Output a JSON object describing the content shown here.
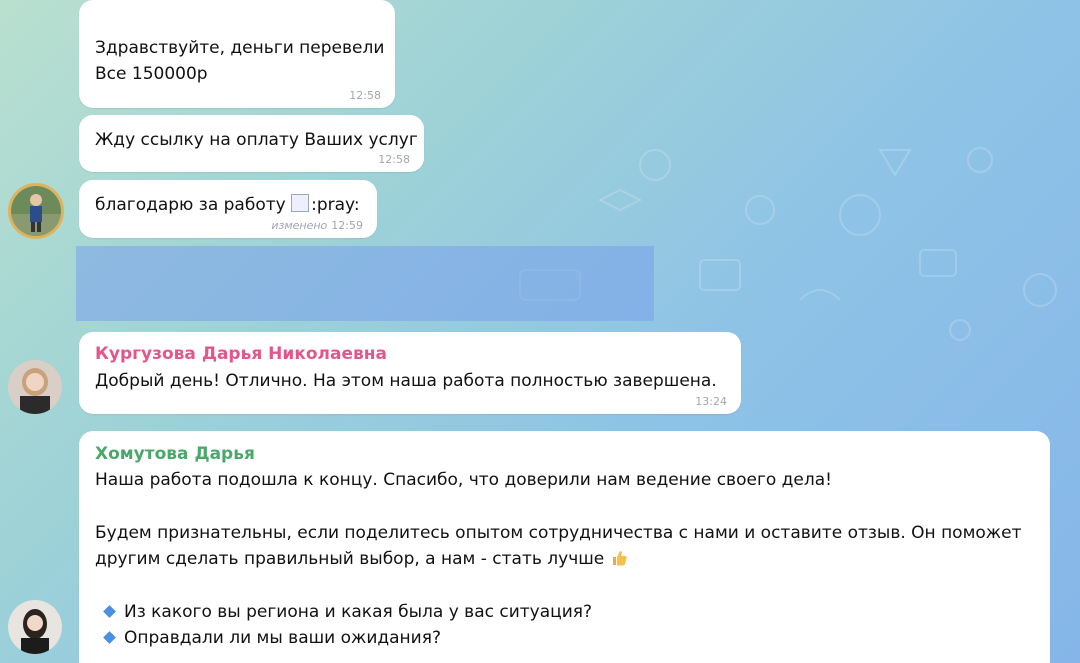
{
  "messages": [
    {
      "text": "Здравствуйте, деньги перевели\nВсе 150000р",
      "time": "12:58"
    },
    {
      "text": "Жду ссылку на оплату Ваших услуг",
      "time": "12:58"
    },
    {
      "text": "благодарю за работу",
      "emoji_alt": ":pray:",
      "edited": "изменено",
      "time": "12:59"
    },
    {
      "sender": "Кургузова Дарья Николаевна",
      "sender_color": "#e3568c",
      "text": "Добрый день! Отлично. На этом наша работа полностью завершена.",
      "time": "13:24"
    },
    {
      "sender": "Хомутова Дарья",
      "sender_color": "#4aa86b",
      "para1": "Наша работа подошла к концу. Спасибо, что доверили нам ведение своего дела!",
      "para2_line1": "Будем признательны, если поделитесь опытом сотрудничества с нами и оставите отзыв. Он поможет",
      "para2_line2": "другим сделать правильный выбор, а нам - стать лучше",
      "bullets": [
        "Из какого вы региона и какая была у вас ситуация?",
        "Оправдали ли мы ваши ожидания?"
      ]
    }
  ],
  "colors": {
    "accent_blue": "#4a90e2",
    "selection": "#7aa0eb"
  },
  "icons": [
    "broken-image-icon",
    "thumbs-up-icon",
    "blue-diamond-icon"
  ]
}
